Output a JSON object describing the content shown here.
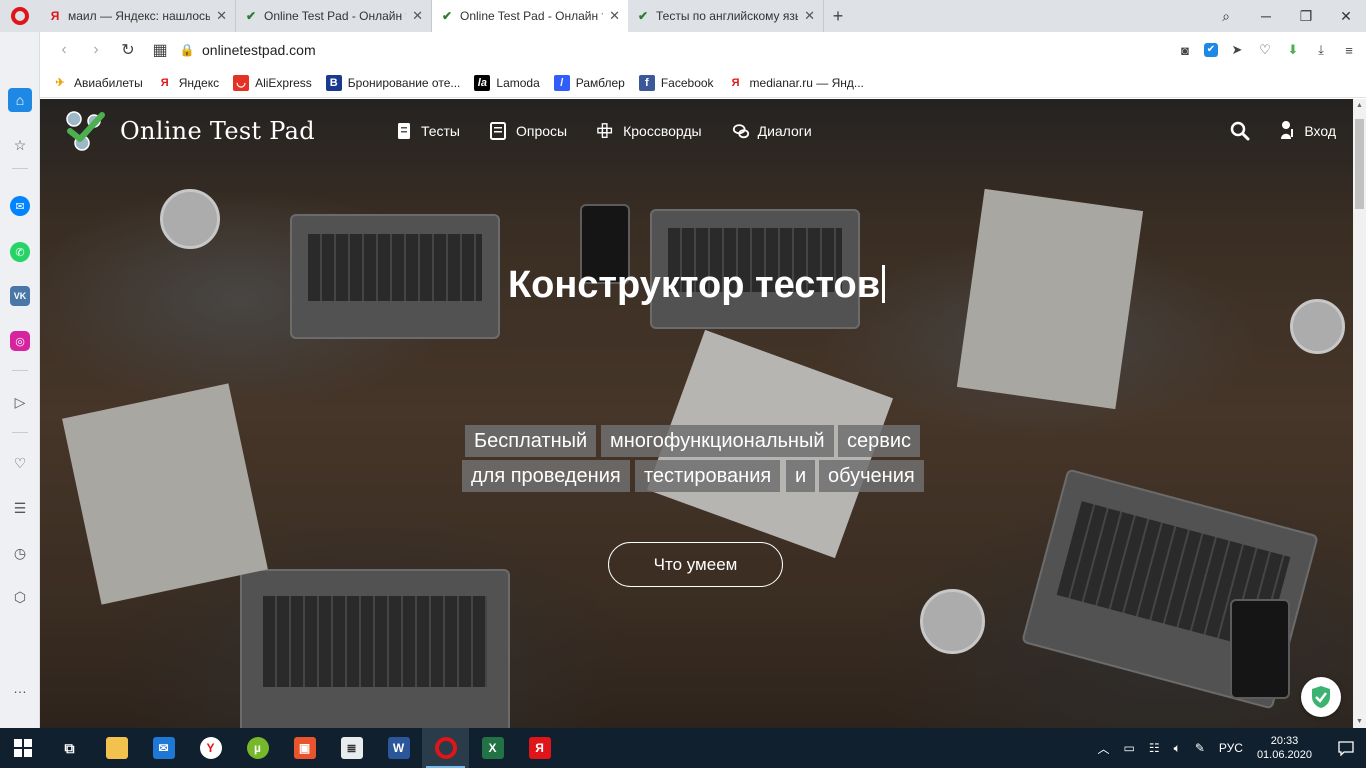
{
  "browser": {
    "tabs": [
      {
        "title": "маил — Яндекс: нашлось",
        "favicon": "yandex-icon"
      },
      {
        "title": "Online Test Pad - Онлайн т",
        "favicon": "otp-icon"
      },
      {
        "title": "Online Test Pad - Онлайн т",
        "favicon": "otp-icon",
        "active": true
      },
      {
        "title": "Тесты по английскому язы",
        "favicon": "otp-icon"
      }
    ],
    "url": "onlinetestpad.com",
    "bookmarks": [
      {
        "label": "Авиабилеты",
        "icon": "plane-icon"
      },
      {
        "label": "Яндекс",
        "icon": "yandex-icon"
      },
      {
        "label": "AliExpress",
        "icon": "aliexpress-icon"
      },
      {
        "label": "Бронирование оте...",
        "icon": "booking-icon"
      },
      {
        "label": "Lamoda",
        "icon": "lamoda-icon"
      },
      {
        "label": "Рамблер",
        "icon": "rambler-icon"
      },
      {
        "label": "Facebook",
        "icon": "facebook-icon"
      },
      {
        "label": "medianar.ru — Янд...",
        "icon": "yandex-icon"
      }
    ]
  },
  "site": {
    "logo_text": "Online Test Pad",
    "menu": [
      {
        "label": "Тесты",
        "icon": "test-doc-icon"
      },
      {
        "label": "Опросы",
        "icon": "poll-icon"
      },
      {
        "label": "Кроссворды",
        "icon": "crossword-icon"
      },
      {
        "label": "Диалоги",
        "icon": "dialog-icon"
      }
    ],
    "login_label": "Вход",
    "hero_title": "Конструктор тестов",
    "tagline_row1": [
      "Бесплатный",
      "многофункциональный",
      "сервис"
    ],
    "tagline_row2": [
      "для проведения",
      "тестирования",
      "и",
      "обучения"
    ],
    "cta_label": "Что умеем"
  },
  "taskbar": {
    "language": "РУС",
    "time": "20:33",
    "date": "01.06.2020"
  },
  "colors": {
    "tag_bg": "#707070",
    "opera_red": "#e0151a",
    "taskbar_bg": "#10202e"
  }
}
